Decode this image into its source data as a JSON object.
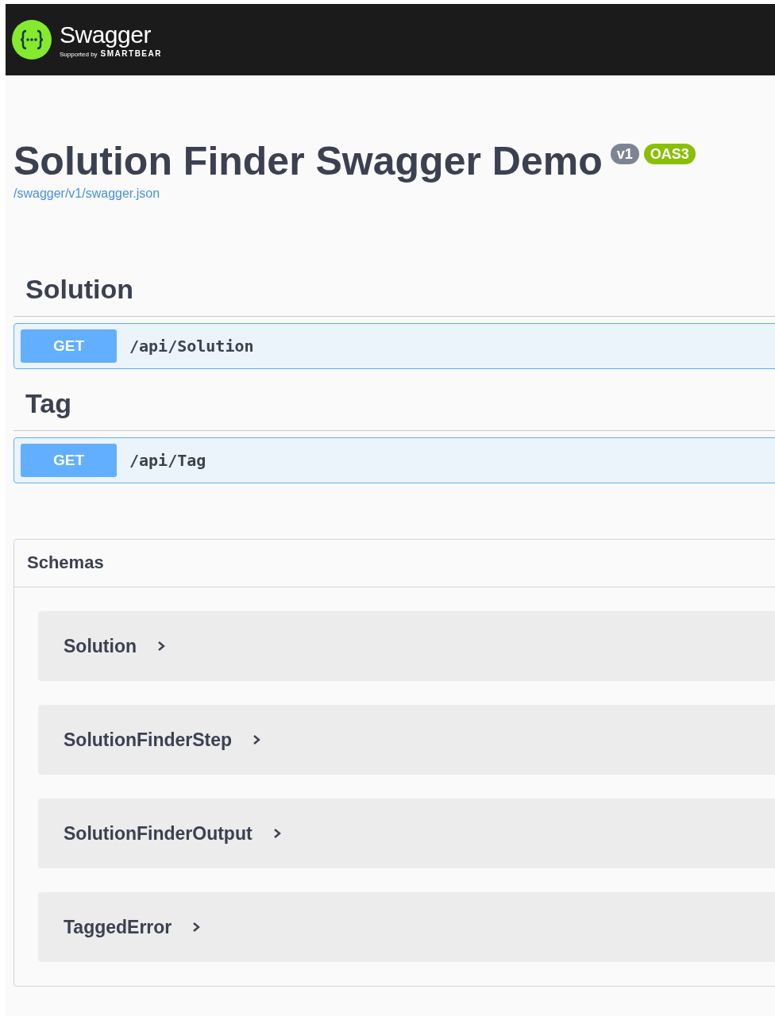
{
  "topbar": {
    "logo_text": "Swagger",
    "tagline_prefix": "Supported by",
    "tagline_brand": "SMARTBEAR"
  },
  "info": {
    "title": "Solution Finder Swagger Demo",
    "badges": [
      {
        "label": "v1",
        "kind": "version"
      },
      {
        "label": "OAS3",
        "kind": "spec"
      }
    ],
    "link": "/swagger/v1/swagger.json"
  },
  "tags": [
    {
      "name": "Solution",
      "operations": [
        {
          "method": "GET",
          "path": "/api/Solution"
        }
      ]
    },
    {
      "name": "Tag",
      "operations": [
        {
          "method": "GET",
          "path": "/api/Tag"
        }
      ]
    }
  ],
  "schemas": {
    "title": "Schemas",
    "items": [
      {
        "name": "Solution",
        "expanded": false
      },
      {
        "name": "SolutionFinderStep",
        "expanded": false
      },
      {
        "name": "SolutionFinderOutput",
        "expanded": false
      },
      {
        "name": "TaggedError",
        "expanded": false
      }
    ]
  }
}
